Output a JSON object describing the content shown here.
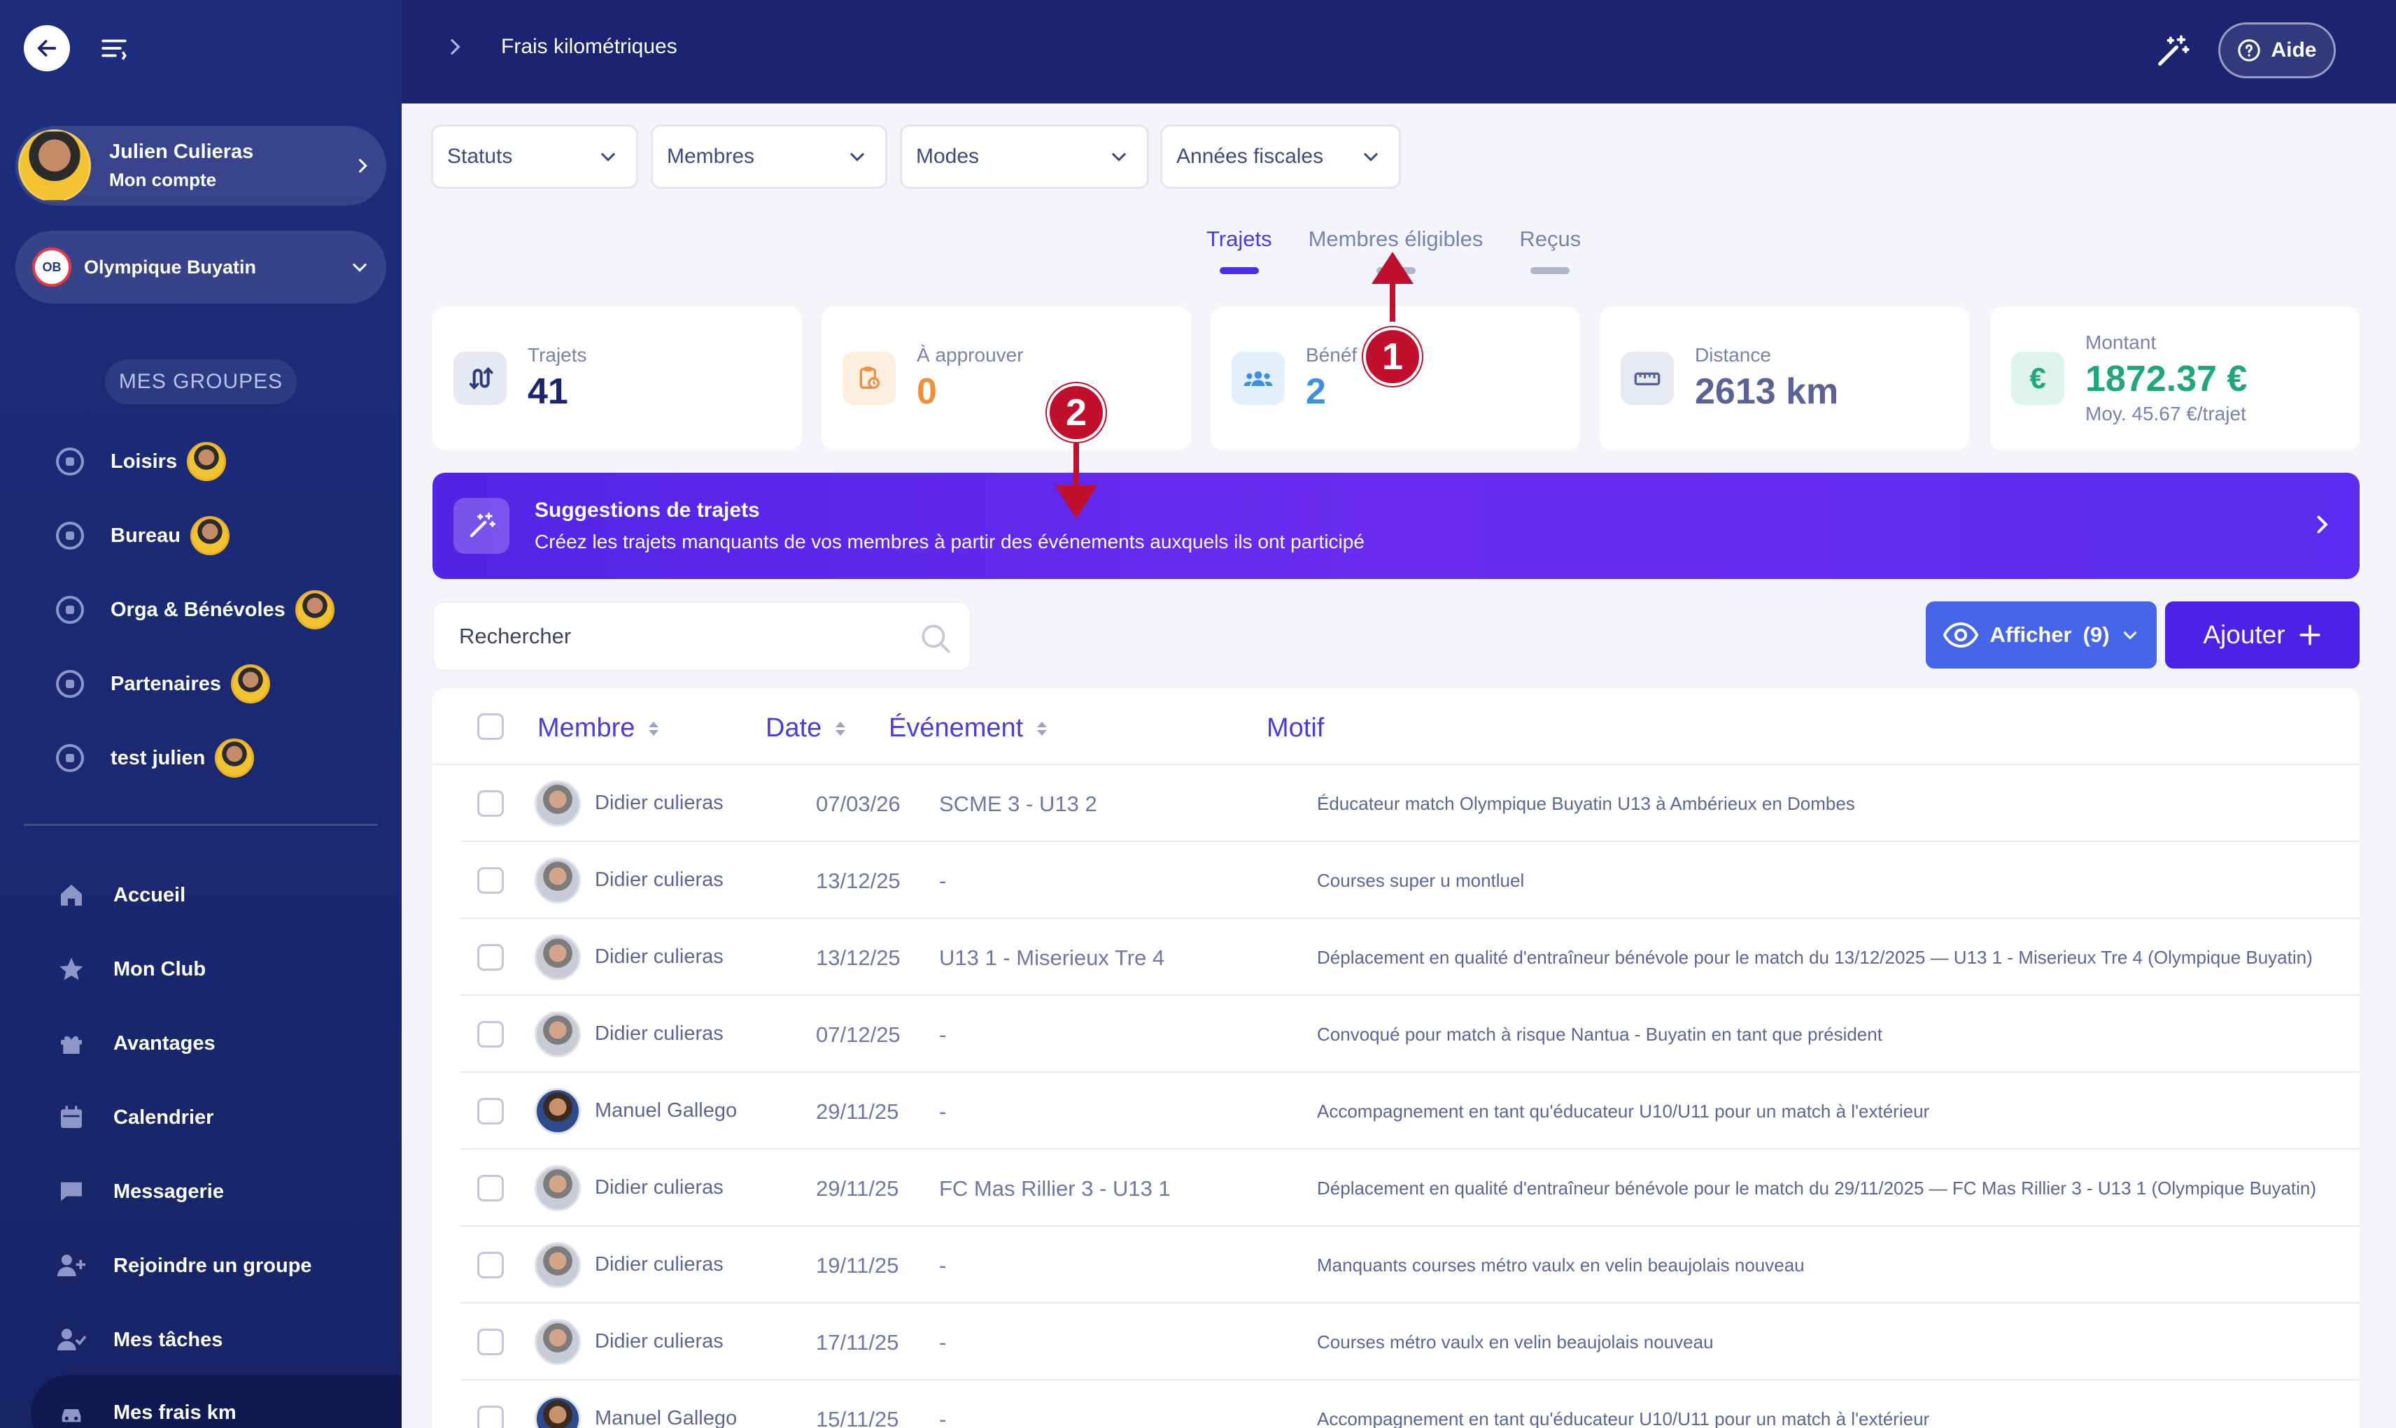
{
  "sidebar": {
    "account": {
      "name": "Julien Culieras",
      "subtitle": "Mon compte"
    },
    "club": {
      "name": "Olympique Buyatin",
      "logo_text": "OB"
    },
    "groups_title": "MES GROUPES",
    "groups": [
      {
        "label": "Loisirs"
      },
      {
        "label": "Bureau"
      },
      {
        "label": "Orga & Bénévoles"
      },
      {
        "label": "Partenaires"
      },
      {
        "label": "test julien"
      }
    ],
    "nav": [
      {
        "label": "Accueil",
        "icon": "home-icon"
      },
      {
        "label": "Mon Club",
        "icon": "star-icon"
      },
      {
        "label": "Avantages",
        "icon": "gift-icon"
      },
      {
        "label": "Calendrier",
        "icon": "calendar-icon"
      },
      {
        "label": "Messagerie",
        "icon": "chat-icon"
      },
      {
        "label": "Rejoindre un groupe",
        "icon": "user-plus-icon"
      },
      {
        "label": "Mes tâches",
        "icon": "user-check-icon"
      },
      {
        "label": "Mes frais km",
        "icon": "car-icon"
      }
    ]
  },
  "header": {
    "title": "Frais kilométriques",
    "help_label": "Aide"
  },
  "filters": [
    {
      "label": "Statuts"
    },
    {
      "label": "Membres"
    },
    {
      "label": "Modes"
    },
    {
      "label": "Années fiscales"
    }
  ],
  "tabs": [
    {
      "label": "Trajets",
      "active": true
    },
    {
      "label": "Membres éligibles",
      "active": false
    },
    {
      "label": "Reçus",
      "active": false
    }
  ],
  "stats": {
    "trajets": {
      "label": "Trajets",
      "value": "41"
    },
    "approuver": {
      "label": "À approuver",
      "value": "0"
    },
    "benef": {
      "label": "Bénéf",
      "value": "2"
    },
    "distance": {
      "label": "Distance",
      "value": "2613 km"
    },
    "montant": {
      "label": "Montant",
      "value": "1872.37 €",
      "sub": "Moy. 45.67 €/trajet"
    }
  },
  "banner": {
    "title": "Suggestions de trajets",
    "subtitle": "Créez les trajets manquants de vos membres à partir des événements auxquels ils ont participé"
  },
  "search": {
    "placeholder": "Rechercher"
  },
  "actions": {
    "show_label": "Afficher",
    "show_count": "(9)",
    "add_label": "Ajouter"
  },
  "table": {
    "columns": {
      "member": "Membre",
      "date": "Date",
      "event": "Événement",
      "motif": "Motif"
    },
    "rows": [
      {
        "member": "Didier culieras",
        "date": "07/03/26",
        "event": "SCME 3 - U13 2",
        "motif": "Éducateur match Olympique Buyatin U13 à Ambérieux en Dombes",
        "avatar": "didier"
      },
      {
        "member": "Didier culieras",
        "date": "13/12/25",
        "event": "-",
        "motif": "Courses super u montluel",
        "avatar": "didier"
      },
      {
        "member": "Didier culieras",
        "date": "13/12/25",
        "event": "U13 1 - Miserieux Tre 4",
        "motif": "Déplacement en qualité d'entraîneur bénévole pour le match du 13/12/2025 — U13 1 - Miserieux Tre 4 (Olympique Buyatin)",
        "avatar": "didier"
      },
      {
        "member": "Didier culieras",
        "date": "07/12/25",
        "event": "-",
        "motif": "Convoqué pour match à risque Nantua - Buyatin en tant que président",
        "avatar": "didier"
      },
      {
        "member": "Manuel Gallego",
        "date": "29/11/25",
        "event": "-",
        "motif": "Accompagnement en tant qu'éducateur U10/U11 pour un match à l'extérieur",
        "avatar": "manuel"
      },
      {
        "member": "Didier culieras",
        "date": "29/11/25",
        "event": "FC Mas Rillier 3 - U13 1",
        "motif": "Déplacement en qualité d'entraîneur bénévole pour le match du 29/11/2025 — FC Mas Rillier 3 - U13 1 (Olympique Buyatin)",
        "avatar": "didier"
      },
      {
        "member": "Didier culieras",
        "date": "19/11/25",
        "event": "-",
        "motif": "Manquants courses métro vaulx en velin beaujolais nouveau",
        "avatar": "didier"
      },
      {
        "member": "Didier culieras",
        "date": "17/11/25",
        "event": "-",
        "motif": "Courses métro vaulx en velin beaujolais nouveau",
        "avatar": "didier"
      },
      {
        "member": "Manuel Gallego",
        "date": "15/11/25",
        "event": "-",
        "motif": "Accompagnement en tant qu'éducateur U10/U11 pour un match à l'extérieur",
        "avatar": "manuel"
      }
    ]
  },
  "annotations": [
    {
      "label": "1"
    },
    {
      "label": "2"
    }
  ],
  "colors": {
    "sidebar": "#1e2c7e",
    "header": "#1b2470",
    "accent": "#4b22e6",
    "banner": "#5a2bf0",
    "annotation": "#c0102e",
    "amount": "#1fa77a",
    "pending": "#f0903a"
  }
}
